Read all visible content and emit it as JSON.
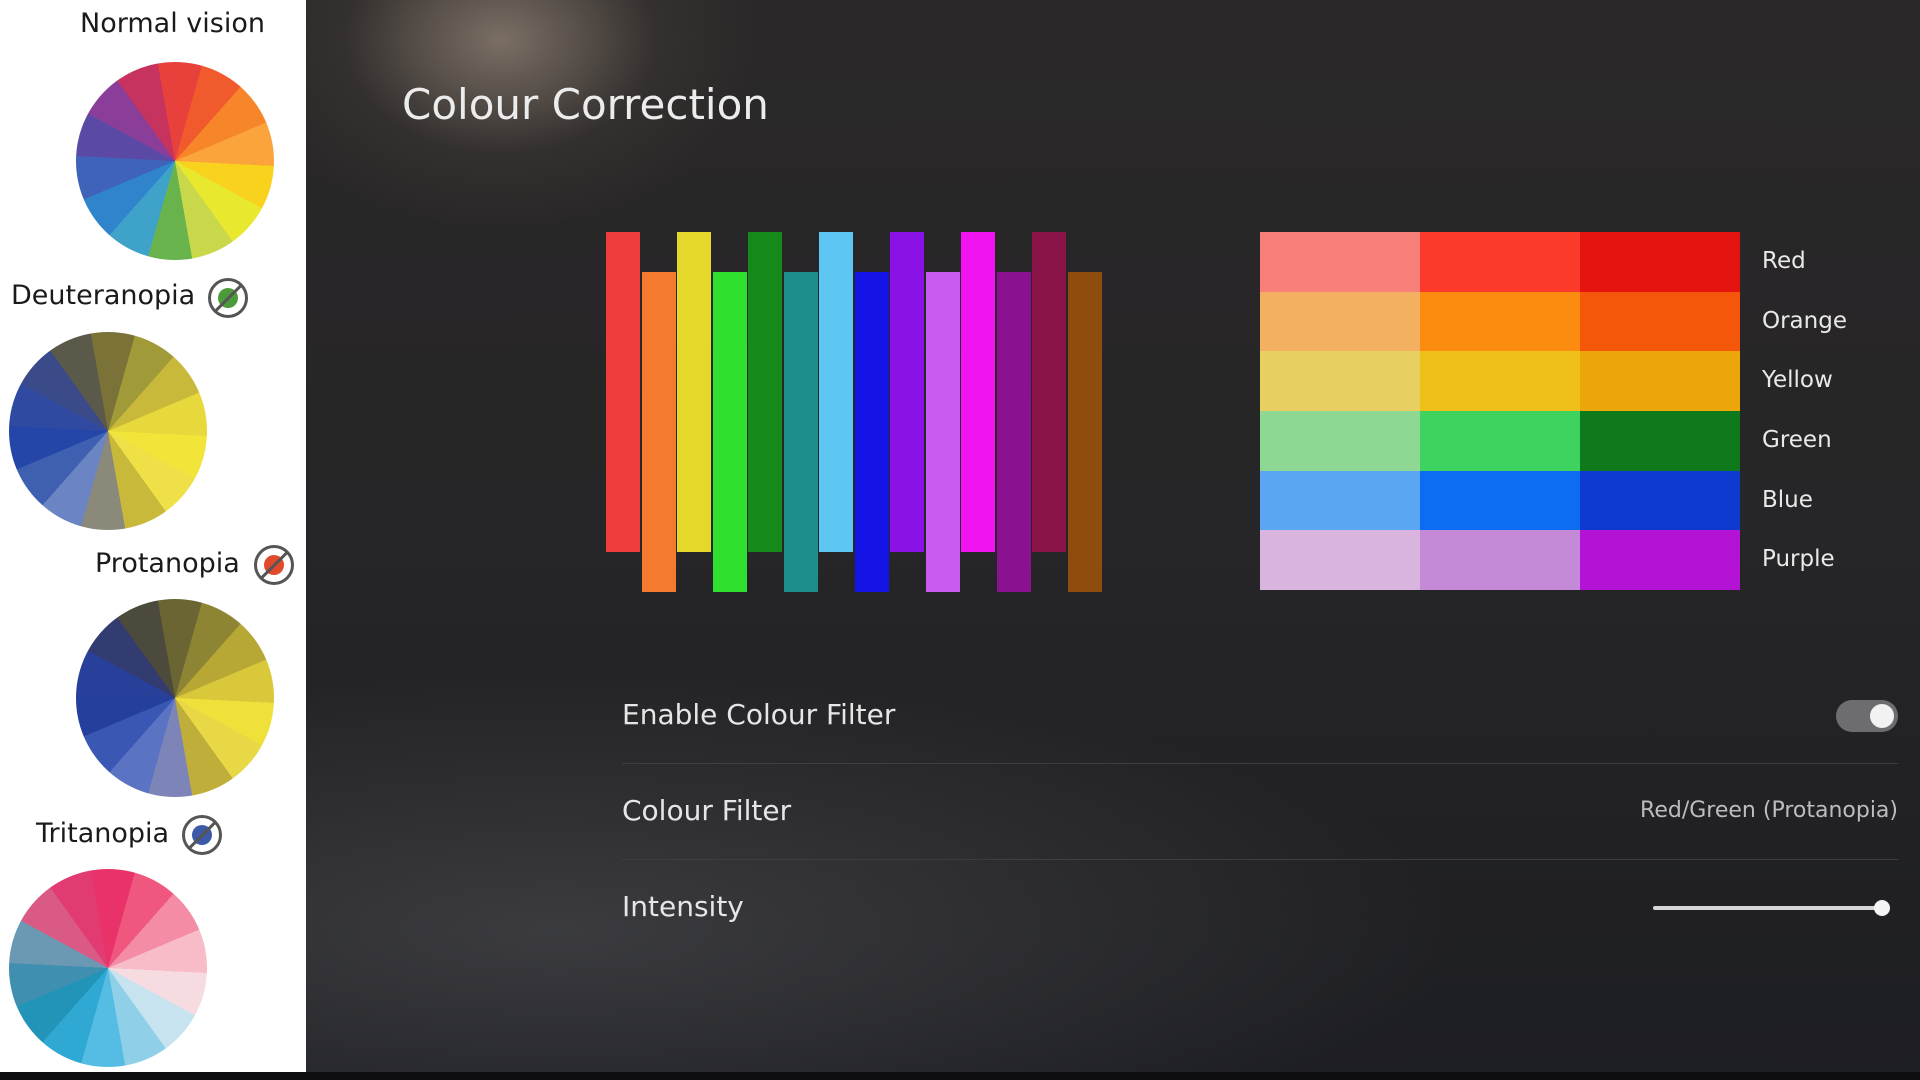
{
  "left_panel": {
    "normal": {
      "label": "Normal vision"
    },
    "deuteranopia": {
      "label": "Deuteranopia",
      "badge_color": "#4c9b3a"
    },
    "protanopia": {
      "label": "Protanopia",
      "badge_color": "#e04a2a"
    },
    "tritanopia": {
      "label": "Tritanopia",
      "badge_color": "#3d5aa8"
    },
    "wheel_colors": {
      "normal": [
        "#e8403b",
        "#f05a2c",
        "#f7862a",
        "#fba43c",
        "#f9d21e",
        "#e8e82f",
        "#c9d84a",
        "#69b34c",
        "#3fa2c8",
        "#2f84cc",
        "#3f63b8",
        "#5b4aa5",
        "#8a3e9a",
        "#c7335f"
      ],
      "deuteranopia": [
        "#7a7237",
        "#a09a38",
        "#c8b93b",
        "#e7d83b",
        "#f1e53a",
        "#efe047",
        "#c9b93a",
        "#8b8a7a",
        "#6b84c4",
        "#3f5fb0",
        "#2446a8",
        "#2f4aa0",
        "#3b4b8a",
        "#5b5a4a"
      ],
      "protanopia": [
        "#6b6533",
        "#8e8534",
        "#b7a836",
        "#d9c93a",
        "#efe13a",
        "#e8d846",
        "#c0ae3a",
        "#7d85b8",
        "#5a73c2",
        "#3a58b3",
        "#243f9c",
        "#28409a",
        "#323c70",
        "#4c4a3c"
      ],
      "tritanopia": [
        "#e9326a",
        "#f0577e",
        "#f48ca6",
        "#f7bcc8",
        "#f6dbe0",
        "#c6e3ef",
        "#8fd0e8",
        "#55bde4",
        "#2fa8d3",
        "#2294b8",
        "#3f8fb0",
        "#6b98b2",
        "#d95a84",
        "#e13b72"
      ]
    }
  },
  "main": {
    "title": "Colour Correction",
    "bars": [
      "#f03c3c",
      "#f47a30",
      "#e4d82a",
      "#2fe02f",
      "#158a1a",
      "#1d8e8c",
      "#5ec6f2",
      "#1414e6",
      "#8a12e6",
      "#c85cf2",
      "#f014f0",
      "#8a1290",
      "#8a1448",
      "#8e4c0e"
    ],
    "swatch_grid": {
      "rows": [
        {
          "label": "Red",
          "colors": [
            "#f88078",
            "#fc3a2c",
            "#e41410"
          ]
        },
        {
          "label": "Orange",
          "colors": [
            "#f2b060",
            "#fb8c10",
            "#f4560a"
          ]
        },
        {
          "label": "Yellow",
          "colors": [
            "#e8cf62",
            "#f0c01a",
            "#eca60a"
          ]
        },
        {
          "label": "Green",
          "colors": [
            "#8ed894",
            "#3ed25e",
            "#0e7a1c"
          ]
        },
        {
          "label": "Blue",
          "colors": [
            "#5aa6f2",
            "#0c6cf2",
            "#0e3ad0"
          ]
        },
        {
          "label": "Purple",
          "colors": [
            "#d8b4de",
            "#c48ad8",
            "#b412d4"
          ]
        }
      ]
    },
    "settings": {
      "enable_filter": {
        "label": "Enable Colour Filter",
        "enabled": true
      },
      "colour_filter": {
        "label": "Colour Filter",
        "value": "Red/Green (Protanopia)"
      },
      "intensity": {
        "label": "Intensity",
        "value_fraction": 1.0
      }
    }
  }
}
